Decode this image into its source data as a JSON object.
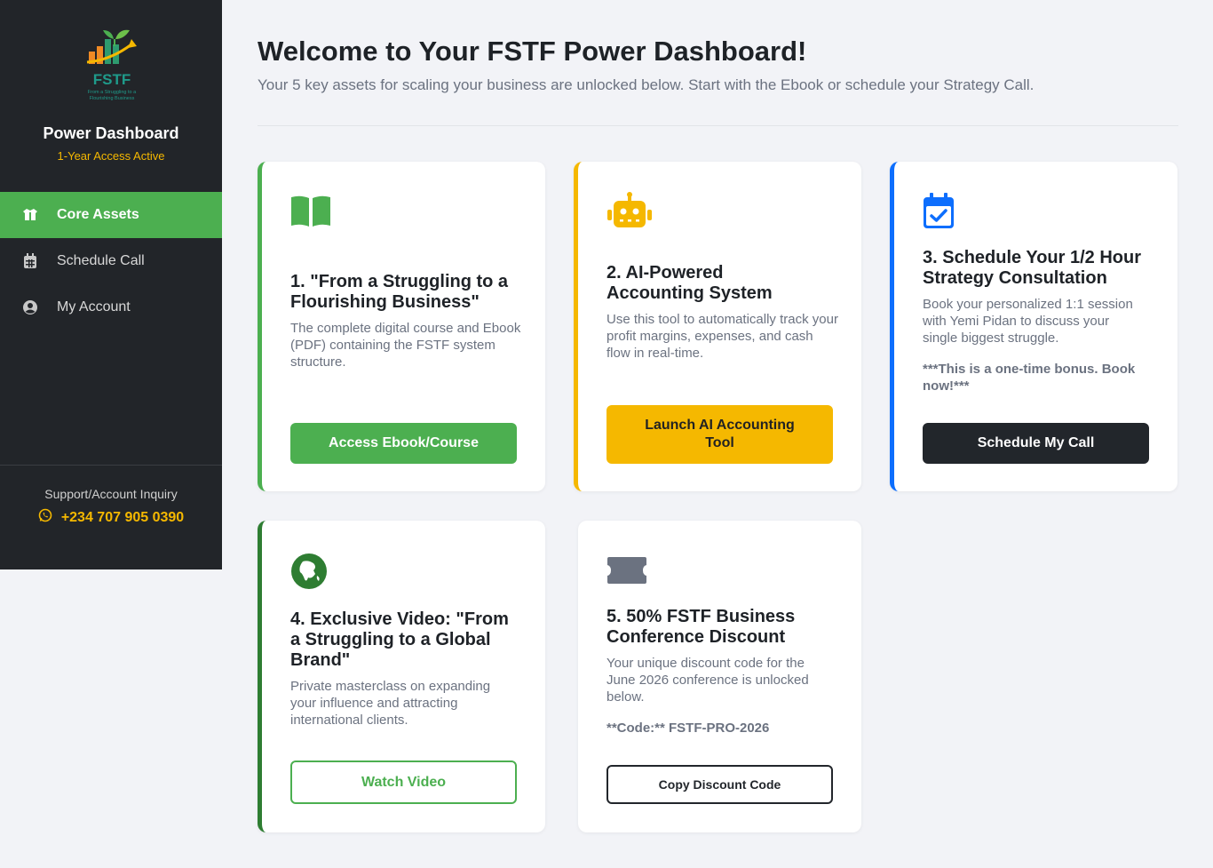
{
  "sidebar": {
    "logo_text": "FSTF",
    "logo_tagline": "From a Struggling to a Flourishing Business",
    "title": "Power Dashboard",
    "subtitle": "1-Year Access Active",
    "nav": [
      {
        "label": "Core Assets",
        "icon": "box-open-icon",
        "active": true
      },
      {
        "label": "Schedule Call",
        "icon": "calendar-icon",
        "active": false
      },
      {
        "label": "My Account",
        "icon": "user-circle-icon",
        "active": false
      }
    ],
    "support_label": "Support/Account Inquiry",
    "support_phone": "+234 707 905 0390"
  },
  "header": {
    "title": "Welcome to Your FSTF Power Dashboard!",
    "subtitle": "Your 5 key assets for scaling your business are unlocked below. Start with the Ebook or schedule your Strategy Call."
  },
  "cards": [
    {
      "title": "1. \"From a Struggling to a Flourishing Business\"",
      "desc": "The complete digital course and Ebook (PDF) containing the FSTF system structure.",
      "button": "Access Ebook/Course",
      "icon": "book-open-icon",
      "accent": "#4caf50"
    },
    {
      "title": "2. AI-Powered Accounting System",
      "desc": "Use this tool to automatically track your profit margins, expenses, and cash flow in real-time.",
      "button": "Launch AI Accounting Tool",
      "icon": "robot-icon",
      "accent": "#f5b800"
    },
    {
      "title": "3. Schedule Your 1/2 Hour Strategy Consultation",
      "desc": "Book your personalized 1:1 session with Yemi Pidan to discuss your single biggest struggle.",
      "note": "***This is a one-time bonus. Book now!***",
      "button": "Schedule My Call",
      "icon": "calendar-check-icon",
      "accent": "#0d6efd"
    },
    {
      "title": "4. Exclusive Video: \"From a Struggling to a Global Brand\"",
      "desc": "Private masterclass on expanding your influence and attracting international clients.",
      "button": "Watch Video",
      "icon": "globe-icon",
      "accent": "#2e7d32"
    },
    {
      "title": "5. 50% FSTF Business Conference Discount",
      "desc": "Your unique discount code for the June 2026 conference is unlocked below.",
      "note": "**Code:** FSTF-PRO-2026",
      "button": "Copy Discount Code",
      "icon": "ticket-icon",
      "accent": "#6b7280"
    }
  ]
}
